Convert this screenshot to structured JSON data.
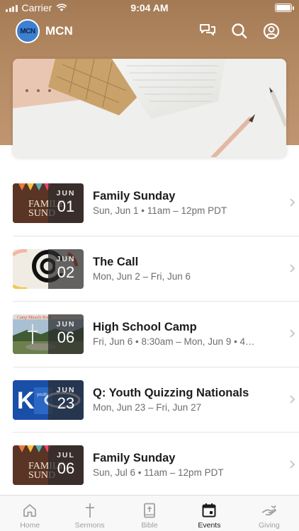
{
  "status_bar": {
    "carrier": "Carrier",
    "time": "9:04 AM"
  },
  "app": {
    "title": "MCN",
    "logo_text": "MCN"
  },
  "header": {
    "icons": [
      "chat-icon",
      "search-icon",
      "profile-icon"
    ],
    "colors": {
      "top": "#a47a55",
      "bottom": "#c09672"
    }
  },
  "events": [
    {
      "title": "Family Sunday",
      "subtitle": "Sun, Jun 1 • 11am – 12pm PDT",
      "month": "JUN",
      "day": "01",
      "thumb": "family-sunday"
    },
    {
      "title": "The Call",
      "subtitle": "Mon, Jun 2 – Fri, Jun 6",
      "month": "JUN",
      "day": "02",
      "thumb": "the-call"
    },
    {
      "title": "High School Camp",
      "subtitle": "Fri, Jun 6 • 8:30am – Mon, Jun 9 • 4…",
      "month": "JUN",
      "day": "06",
      "thumb": "camp"
    },
    {
      "title": "Q: Youth Quizzing Nationals",
      "subtitle": "Mon, Jun 23 – Fri, Jun 27",
      "month": "JUN",
      "day": "23",
      "thumb": "quizzing"
    },
    {
      "title": "Family Sunday",
      "subtitle": "Sun, Jul 6 • 11am – 12pm PDT",
      "month": "JUL",
      "day": "06",
      "thumb": "family-sunday"
    }
  ],
  "tabs": [
    {
      "label": "Home",
      "icon": "home-icon",
      "active": false
    },
    {
      "label": "Sermons",
      "icon": "cross-icon",
      "active": false
    },
    {
      "label": "Bible",
      "icon": "bible-icon",
      "active": false
    },
    {
      "label": "Events",
      "icon": "calendar-icon",
      "active": true
    },
    {
      "label": "Giving",
      "icon": "giving-hand-icon",
      "active": false
    }
  ]
}
